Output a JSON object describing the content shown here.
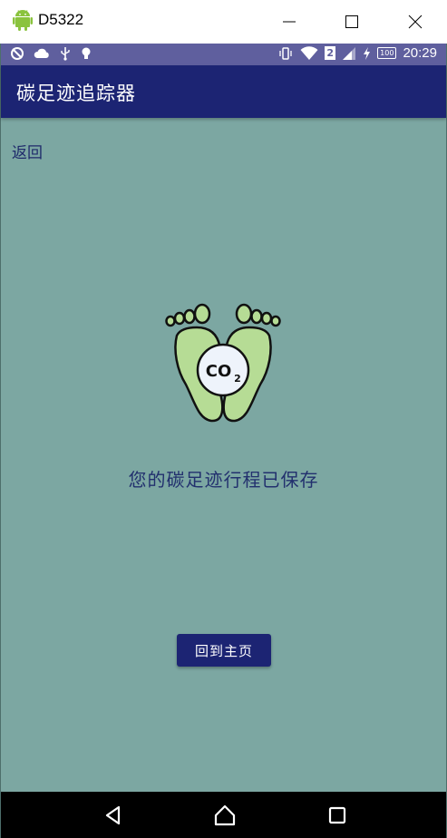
{
  "window": {
    "title": "D5322"
  },
  "status_bar": {
    "time": "20:29",
    "sim_slot": "2",
    "battery_level": "100"
  },
  "app_bar": {
    "title": "碳足迹追踪器"
  },
  "main": {
    "back_label": "返回",
    "illustration": {
      "name": "footprint-co2-icon",
      "text": "CO2"
    },
    "message": "您的碳足迹行程已保存",
    "home_button_label": "回到主页"
  },
  "nav_bar": {
    "icons": [
      "back-triangle-icon",
      "home-circle-icon",
      "recents-square-icon"
    ]
  },
  "colors": {
    "background": "#7ca7a2",
    "app_bar": "#1c2473",
    "status_bar": "#5f5f9e",
    "text_dark": "#22306e",
    "foot_fill": "#b6dc95"
  }
}
